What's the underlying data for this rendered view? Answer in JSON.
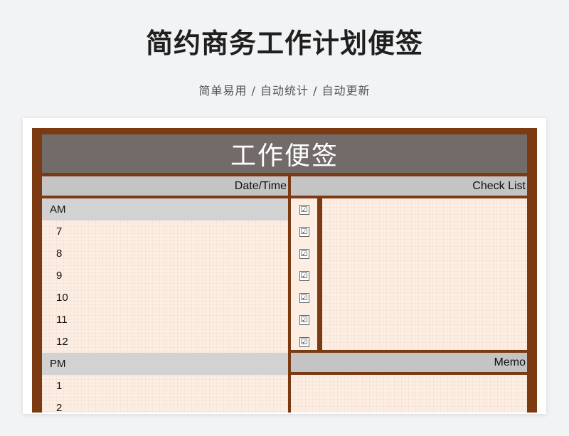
{
  "header": {
    "title": "简约商务工作计划便签",
    "subtitle": "简单易用  /  自动统计  /  自动更新"
  },
  "planner": {
    "banner_title": "工作便签",
    "date_time_label": "Date/Time",
    "check_list_label": "Check List",
    "memo_label": "Memo",
    "am_label": "AM",
    "am_hours": [
      "7",
      "8",
      "9",
      "10",
      "11",
      "12"
    ],
    "pm_label": "PM",
    "pm_hours": [
      "1",
      "2"
    ],
    "checkbox_glyph": "☑"
  },
  "colors": {
    "frame": "#7b3a12",
    "banner": "#726b69",
    "header_bar": "#c4c4c4",
    "paper": "#fdeee3"
  }
}
